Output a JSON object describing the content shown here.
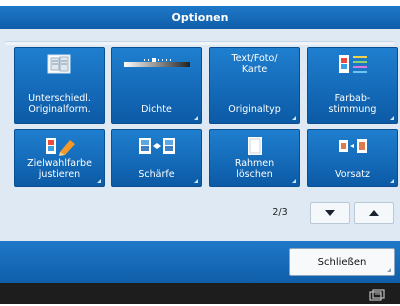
{
  "dialog": {
    "title": "Optionen"
  },
  "tiles": [
    {
      "label": "Unterschiedl.\nOriginalform.",
      "icon": "original-sizes-icon"
    },
    {
      "label": "Dichte",
      "icon": "density-slider-icon"
    },
    {
      "label": "Originaltyp",
      "icon_text": "Text/Foto/\nKarte"
    },
    {
      "label": "Farbab-\nstimmung",
      "icon": "color-balance-icon"
    },
    {
      "label": "Zielwahlfarbe\njustieren",
      "icon": "target-color-icon"
    },
    {
      "label": "Schärfe",
      "icon": "sharpness-icon"
    },
    {
      "label": "Rahmen\nlöschen",
      "icon": "erase-frame-icon"
    },
    {
      "label": "Vorsatz",
      "icon": "cover-page-icon"
    }
  ],
  "pagination": {
    "page": "2/3"
  },
  "footer": {
    "close_label": "Schließen"
  },
  "status": {
    "icon": "device-status-icon"
  },
  "colors": {
    "accent": "#1a6fc0",
    "panel": "#dfe9f3",
    "status_bar": "#1d1d1d"
  }
}
